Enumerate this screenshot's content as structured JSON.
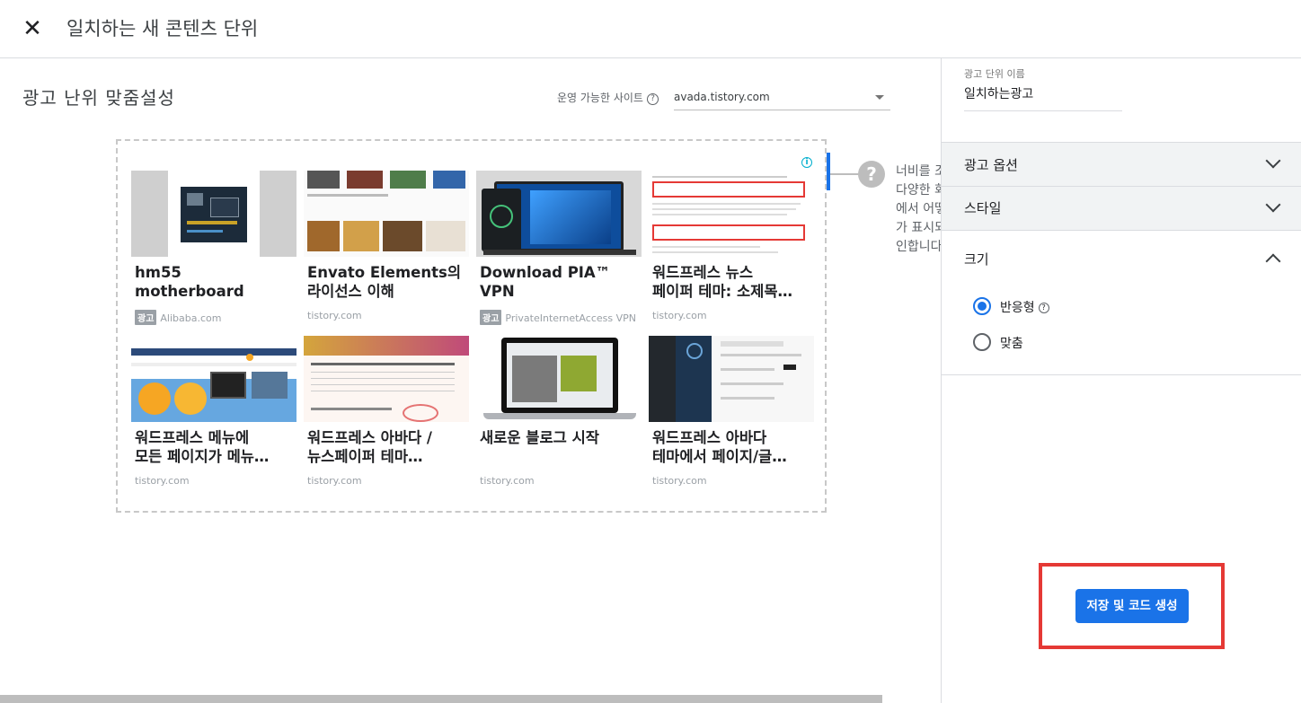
{
  "header": {
    "title": "일치하는 새 콘텐츠 단위",
    "close_icon": "close-icon"
  },
  "main": {
    "section_title": "광고 난위 맞줌설성",
    "site_label": "운영 가능한 사이트",
    "site_value": "avada.tistory.com",
    "help_text": [
      "너비를 조",
      "다양한 화",
      "에서 어떻",
      "가 표시되",
      "인합니다"
    ],
    "cards": [
      {
        "title": "hm55 motherboard",
        "ad": "광고",
        "source": "Alibaba.com"
      },
      {
        "title": "Envato Elements의\n라이선스 이해",
        "ad": "",
        "source": "tistory.com"
      },
      {
        "title": "Download PIA™ VPN",
        "ad": "광고",
        "source": "PrivateInternetAccess VPN"
      },
      {
        "title": "워드프레스 뉴스\n페이퍼 테마: 소제목…",
        "ad": "",
        "source": "tistory.com"
      },
      {
        "title": "워드프레스 메뉴에\n모든 페이지가 메뉴…",
        "ad": "",
        "source": "tistory.com"
      },
      {
        "title": "워드프레스 아바다 /\n뉴스페이퍼 테마…",
        "ad": "",
        "source": "tistory.com"
      },
      {
        "title": "새로운 블로그 시작",
        "ad": "",
        "source": "tistory.com"
      },
      {
        "title": "워드프레스 아바다\n테마에서 페이지/글…",
        "ad": "",
        "source": "tistory.com"
      }
    ]
  },
  "panel": {
    "name_label": "광고 단위 이름",
    "name_value": "일치하는광고",
    "sections": [
      {
        "label": "광고 옵션",
        "expanded": false
      },
      {
        "label": "스타일",
        "expanded": false
      },
      {
        "label": "크기",
        "expanded": true
      }
    ],
    "size_options": [
      {
        "label": "반응형",
        "checked": true
      },
      {
        "label": "맞춤",
        "checked": false
      }
    ],
    "save_button": "저장 및 코드 생성"
  },
  "colors": {
    "accent": "#1a73e8",
    "highlight": "#e53935"
  }
}
